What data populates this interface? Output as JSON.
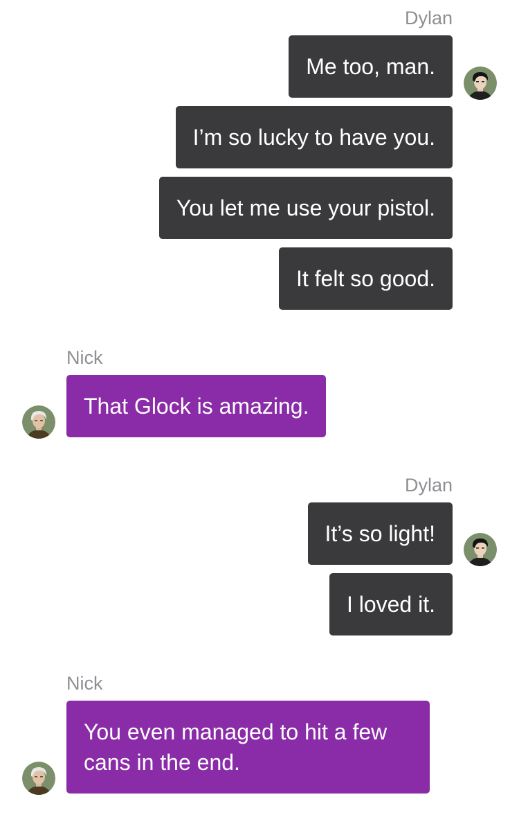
{
  "conversation": {
    "groups": [
      {
        "sender": "Dylan",
        "messages": [
          "Me too, man.",
          "I’m so lucky to have you.",
          "You let me use your pistol.",
          "It felt so good."
        ]
      },
      {
        "sender": "Nick",
        "messages": [
          "That Glock is amazing."
        ]
      },
      {
        "sender": "Dylan",
        "messages": [
          "It’s so light!",
          "I loved it."
        ]
      },
      {
        "sender": "Nick",
        "messages": [
          "You even managed to hit a few cans in the end."
        ]
      }
    ]
  },
  "colors": {
    "outgoing_bubble": "#3a3a3c",
    "incoming_bubble": "#8a2ba8",
    "sender_name": "#8e8e93",
    "avatar_background": "#7a8f6a"
  },
  "icons": {
    "dylan_avatar": "avatar-dylan",
    "nick_avatar": "avatar-nick"
  }
}
